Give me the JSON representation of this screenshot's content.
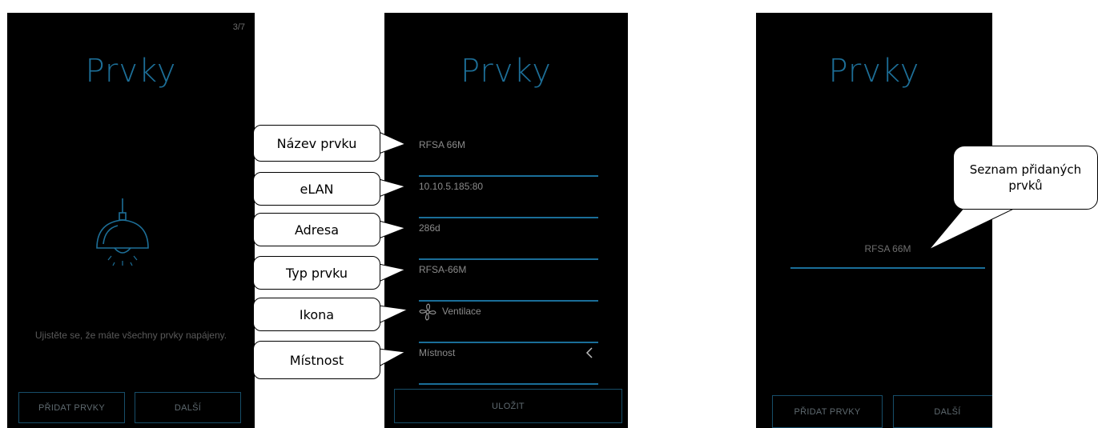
{
  "screen1": {
    "step": "3/7",
    "title": "Prvky",
    "hint": "Ujistěte se, že máte všechny prvky napájeny.",
    "add_button": "PŘIDAT PRVKY",
    "next_button": "DALŠÍ"
  },
  "screen2": {
    "title": "Prvky",
    "fields": {
      "name": "RFSA 66M",
      "elan": "10.10.5.185:80",
      "address": "286d",
      "type": "RFSA-66M",
      "icon_label": "Ventilace",
      "room": "Místnost"
    },
    "save_button": "ULOŽIT"
  },
  "screen3": {
    "title": "Prvky",
    "list_items": [
      "RFSA 66M"
    ],
    "add_button": "PŘIDAT PRVKY",
    "next_button": "DALŠÍ"
  },
  "callouts": {
    "name": "Název prvku",
    "elan": "eLAN",
    "address": "Adresa",
    "type": "Typ prvku",
    "icon": "Ikona",
    "room": "Místnost",
    "added_list": "Seznam přidaných prvků"
  },
  "colors": {
    "accent": "#1d6f98",
    "background": "#000000",
    "line": "#1a6e99"
  }
}
